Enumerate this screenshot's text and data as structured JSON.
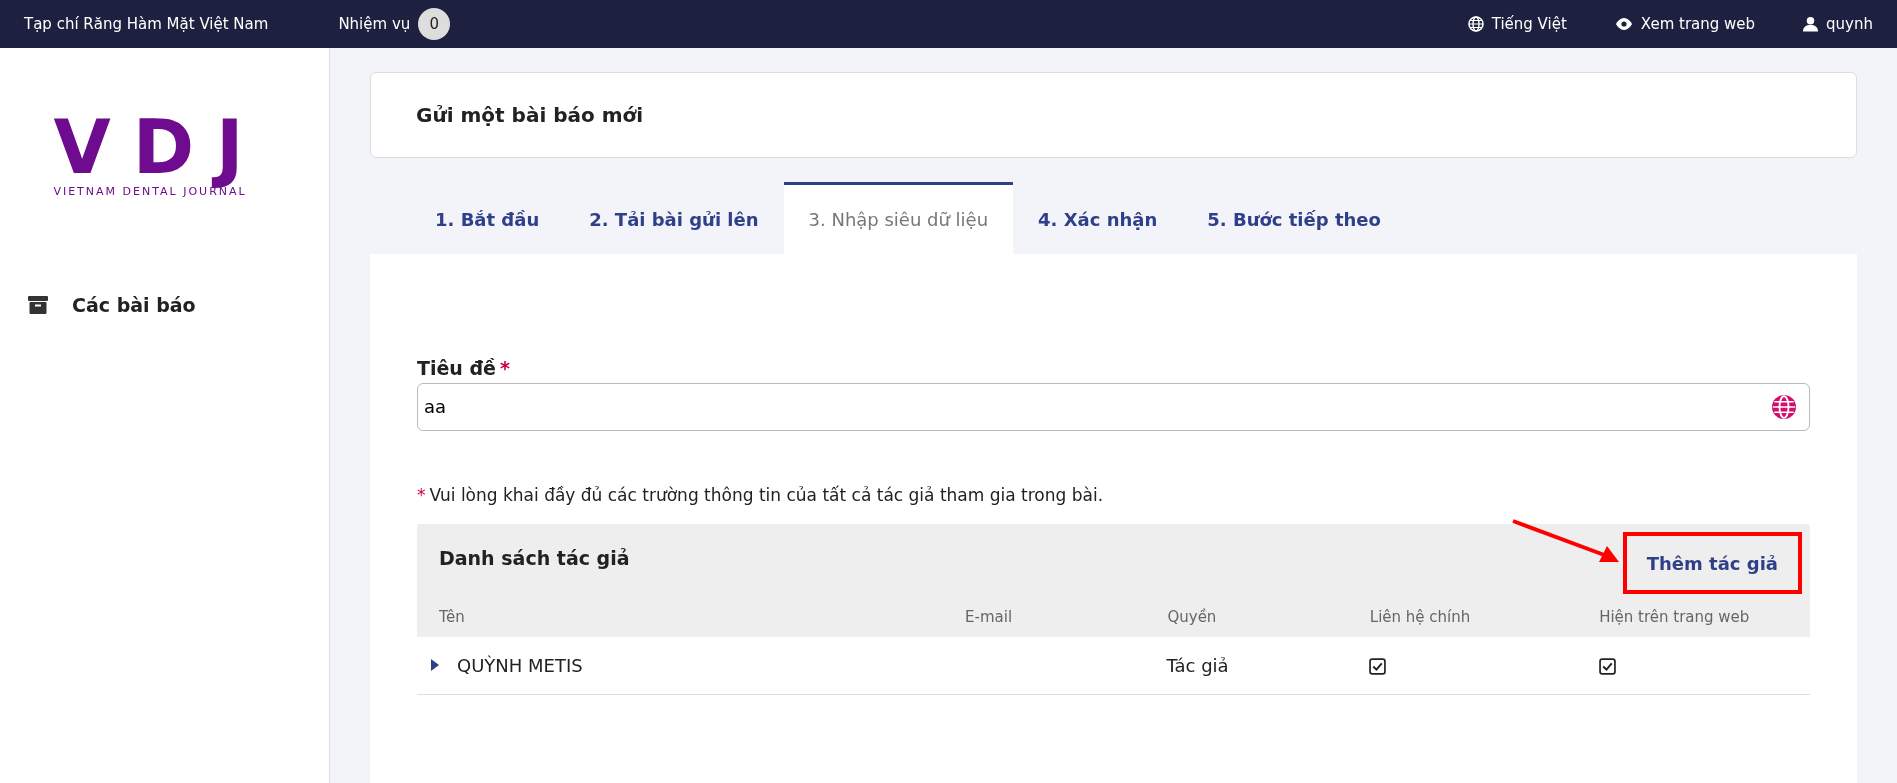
{
  "topbar": {
    "site_title": "Tạp chí Răng Hàm Mặt Việt Nam",
    "tasks": {
      "label": "Nhiệm vụ",
      "count": "0"
    },
    "language": "Tiếng Việt",
    "view_site": "Xem trang web",
    "user": "quynh"
  },
  "sidebar": {
    "logo": {
      "mark": "VDJ",
      "tagline": "VIETNAM DENTAL JOURNAL"
    },
    "items": [
      {
        "label": "Các bài báo",
        "selected": false
      }
    ]
  },
  "page_title": "Gửi một bài báo mới",
  "tabs": [
    {
      "label": "1. Bắt đầu",
      "selected": false
    },
    {
      "label": "2. Tải bài gửi lên",
      "selected": false
    },
    {
      "label": "3. Nhập siêu dữ liệu",
      "selected": true
    },
    {
      "label": "4. Xác nhận",
      "selected": false
    },
    {
      "label": "5. Bước tiếp theo",
      "selected": false
    }
  ],
  "form": {
    "title_label": "Tiêu đề",
    "required_mark": "*",
    "title_value": "aa",
    "note_mark": "*",
    "note": "Vui lòng khai đầy đủ các trường thông tin của tất cả tác giả tham gia trong bài."
  },
  "authors": {
    "title": "Danh sách tác giả",
    "add_button": "Thêm tác giả",
    "columns": [
      "Tên",
      "E-mail",
      "Quyền",
      "Liên hệ chính",
      "Hiện trên trang web"
    ],
    "rows": [
      {
        "expanded": false,
        "name": "QUỲNH METIS",
        "email": "",
        "role": "Tác giả",
        "primary_contact": true,
        "show_on_site": true
      }
    ]
  }
}
